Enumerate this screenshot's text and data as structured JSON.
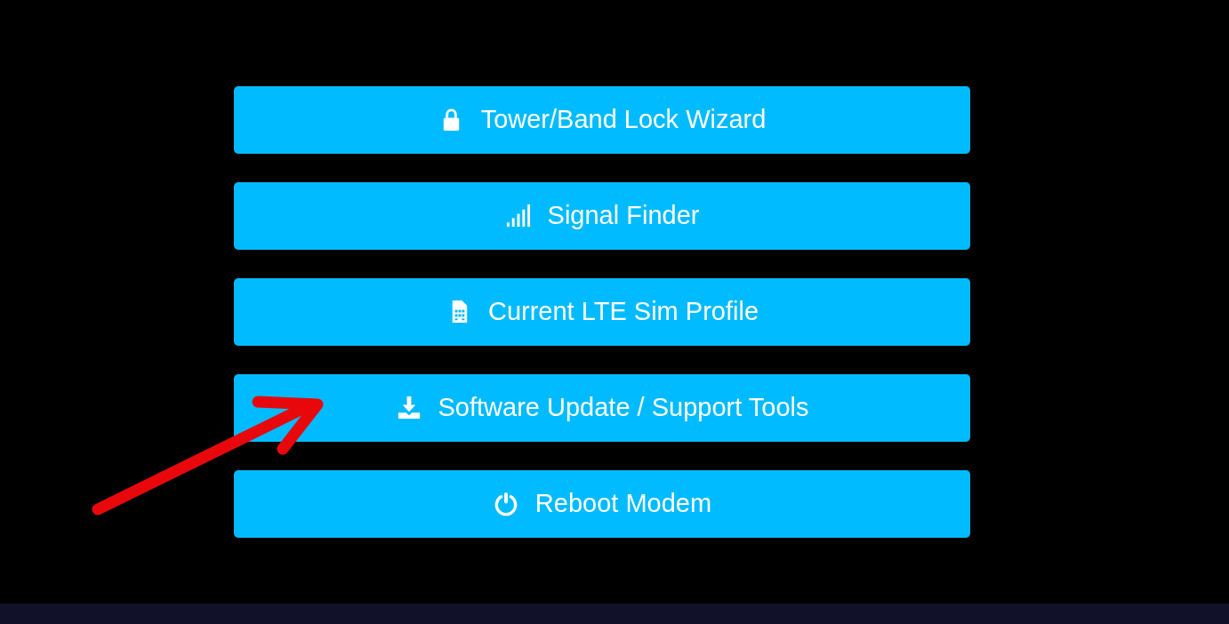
{
  "buttons": [
    {
      "label": "Tower/Band Lock Wizard"
    },
    {
      "label": "Signal Finder"
    },
    {
      "label": "Current LTE Sim Profile"
    },
    {
      "label": "Software Update / Support Tools"
    },
    {
      "label": "Reboot Modem"
    }
  ]
}
